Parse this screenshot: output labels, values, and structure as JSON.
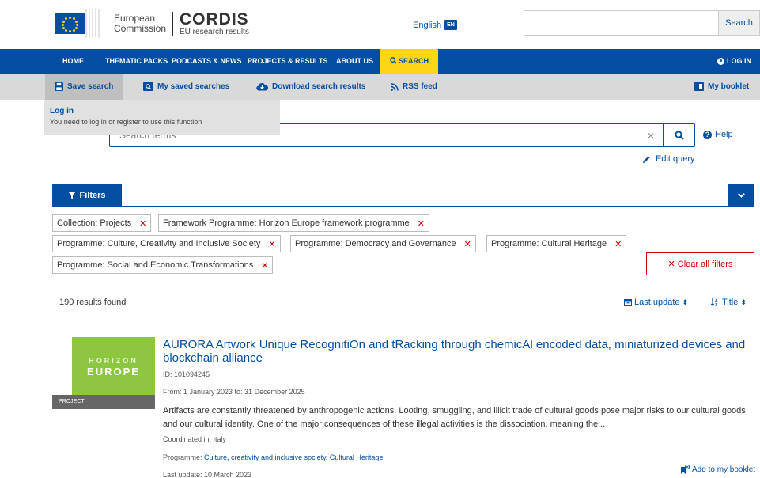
{
  "header": {
    "ec_line1": "European",
    "ec_line2": "Commission",
    "cordis_title": "CORDIS",
    "cordis_sub": "EU research results",
    "language": "English",
    "language_code": "EN",
    "search_placeholder": "",
    "search_button": "Search"
  },
  "nav": {
    "home": "HOME",
    "thematic": "THEMATIC PACKS",
    "podcasts": "PODCASTS & NEWS",
    "projects": "PROJECTS & RESULTS",
    "about": "ABOUT US",
    "search": "SEARCH",
    "login": "LOG IN"
  },
  "tools": {
    "save_search": "Save search",
    "my_saved": "My saved searches",
    "download": "Download search results",
    "rss": "RSS feed",
    "booklet": "My booklet"
  },
  "login_popup": {
    "title": "Log in",
    "text": "You need to log in or register to use this function"
  },
  "search": {
    "placeholder": "Search terms",
    "help": "Help",
    "edit_query": "Edit query"
  },
  "filters": {
    "tab_label": "Filters",
    "chips": [
      "Collection: Projects",
      "Framework Programme: Horizon Europe framework programme",
      "Programme: Culture, Creativity and Inclusive Society",
      "Programme: Democracy and Governance",
      "Programme: Cultural Heritage",
      "Programme: Social and Economic Transformations"
    ],
    "clear_all": "Clear all filters"
  },
  "results": {
    "count": "190 results found",
    "sort_update": "Last update",
    "sort_title": "Title"
  },
  "item": {
    "thumb_line1": "HORIZON",
    "thumb_line2": "EUROPE",
    "thumb_label": "PROJECT",
    "title": "AURORA Artwork Unique RecognitiOn and tRacking through chemicAl encoded data, miniaturized devices and blockchain alliance",
    "id": "ID: 101094245",
    "dates": "From: 1 January 2023 to: 31 December 2025",
    "description": "Artifacts are constantly threatened by anthropogenic actions. Looting, smuggling, and illicit trade of cultural goods pose major risks to our cultural goods and our cultural identity. One of the major consequences of these illegal activities is the dissociation, meaning the...",
    "coordinated": "Coordinated in: Italy",
    "programme_label": "Programme: ",
    "programme_links": "Culture, creativity and inclusive society, Cultural Heritage",
    "last_update": "Last update: 10 March 2023",
    "add_booklet": "Add to my booklet"
  },
  "colors": {
    "brand_blue": "#034ea2",
    "accent_yellow": "#ffd617",
    "remove_red": "#cc0000",
    "horizon_green": "#8dc63f"
  }
}
